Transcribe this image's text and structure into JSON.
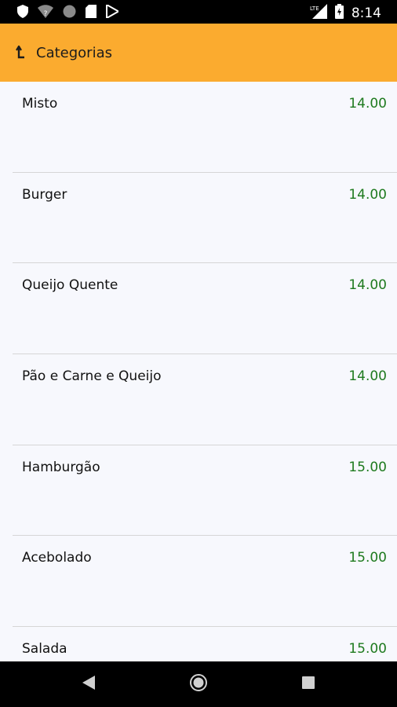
{
  "status_bar": {
    "time": "8:14",
    "icons": [
      "shield-icon",
      "wifi-question-icon",
      "circle-icon",
      "sd-card-icon",
      "play-store-icon",
      "lte-signal-icon",
      "battery-icon"
    ]
  },
  "app_bar": {
    "title": "Categorias",
    "back_icon": "back-arrow-icon"
  },
  "items": [
    {
      "name": "Misto",
      "price": "14.00"
    },
    {
      "name": "Burger",
      "price": "14.00"
    },
    {
      "name": "Queijo Quente",
      "price": "14.00"
    },
    {
      "name": "Pão e Carne e Queijo",
      "price": "14.00"
    },
    {
      "name": "Hamburgão",
      "price": "15.00"
    },
    {
      "name": "Acebolado",
      "price": "15.00"
    },
    {
      "name": "Salada",
      "price": "15.00"
    }
  ],
  "nav_bar": {
    "back": "back-triangle-icon",
    "home": "home-circle-icon",
    "recents": "recents-square-icon"
  },
  "colors": {
    "app_bar": "#fbab2f",
    "price": "#1e7a1e",
    "list_bg": "#f7f8fd"
  }
}
